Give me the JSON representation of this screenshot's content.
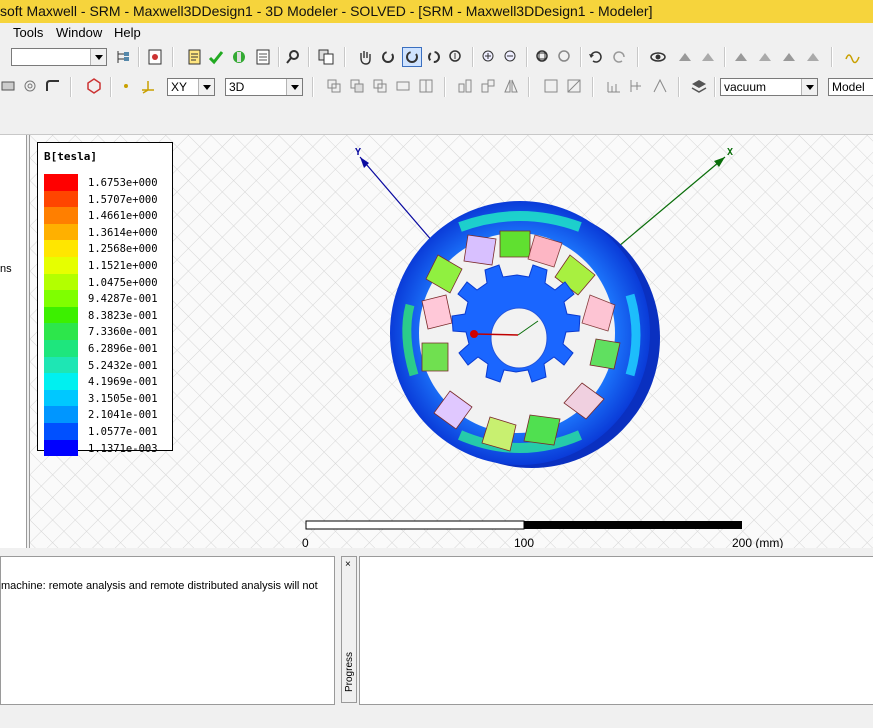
{
  "window": {
    "title": "soft Maxwell - SRM - Maxwell3DDesign1 - 3D Modeler - SOLVED - [SRM - Maxwell3DDesign1 - Modeler]"
  },
  "menu": [
    "Tools",
    "Window",
    "Help"
  ],
  "toolbar": {
    "combo_blank": "",
    "plane": "XY",
    "model_type": "3D",
    "material": "vacuum",
    "mode": "Model"
  },
  "left_panel": {
    "partial_text": "ns"
  },
  "viewport": {
    "legend": {
      "title": "B[tesla]",
      "values": [
        "1.6753e+000",
        "1.5707e+000",
        "1.4661e+000",
        "1.3614e+000",
        "1.2568e+000",
        "1.1521e+000",
        "1.0475e+000",
        "9.4287e-001",
        "8.3823e-001",
        "7.3360e-001",
        "6.2896e-001",
        "5.2432e-001",
        "4.1969e-001",
        "3.1505e-001",
        "2.1041e-001",
        "1.0577e-001",
        "1.1371e-003"
      ],
      "colors": [
        "#ff0000",
        "#ff4500",
        "#ff7f00",
        "#ffb000",
        "#ffe600",
        "#e6ff00",
        "#b3ff00",
        "#7fff00",
        "#3cf000",
        "#2de64b",
        "#1ee67d",
        "#1ee6b4",
        "#00f0f0",
        "#00c8ff",
        "#0096ff",
        "#0050ff",
        "#0000ff"
      ]
    },
    "axes": {
      "x_label": "X",
      "y_label": "Y"
    },
    "scale_bar": {
      "labels": [
        "0",
        "100",
        "200 (mm)"
      ]
    }
  },
  "messages": {
    "text": "machine: remote analysis and remote distributed analysis will not"
  },
  "progress": {
    "label": "Progress",
    "close": "×"
  }
}
